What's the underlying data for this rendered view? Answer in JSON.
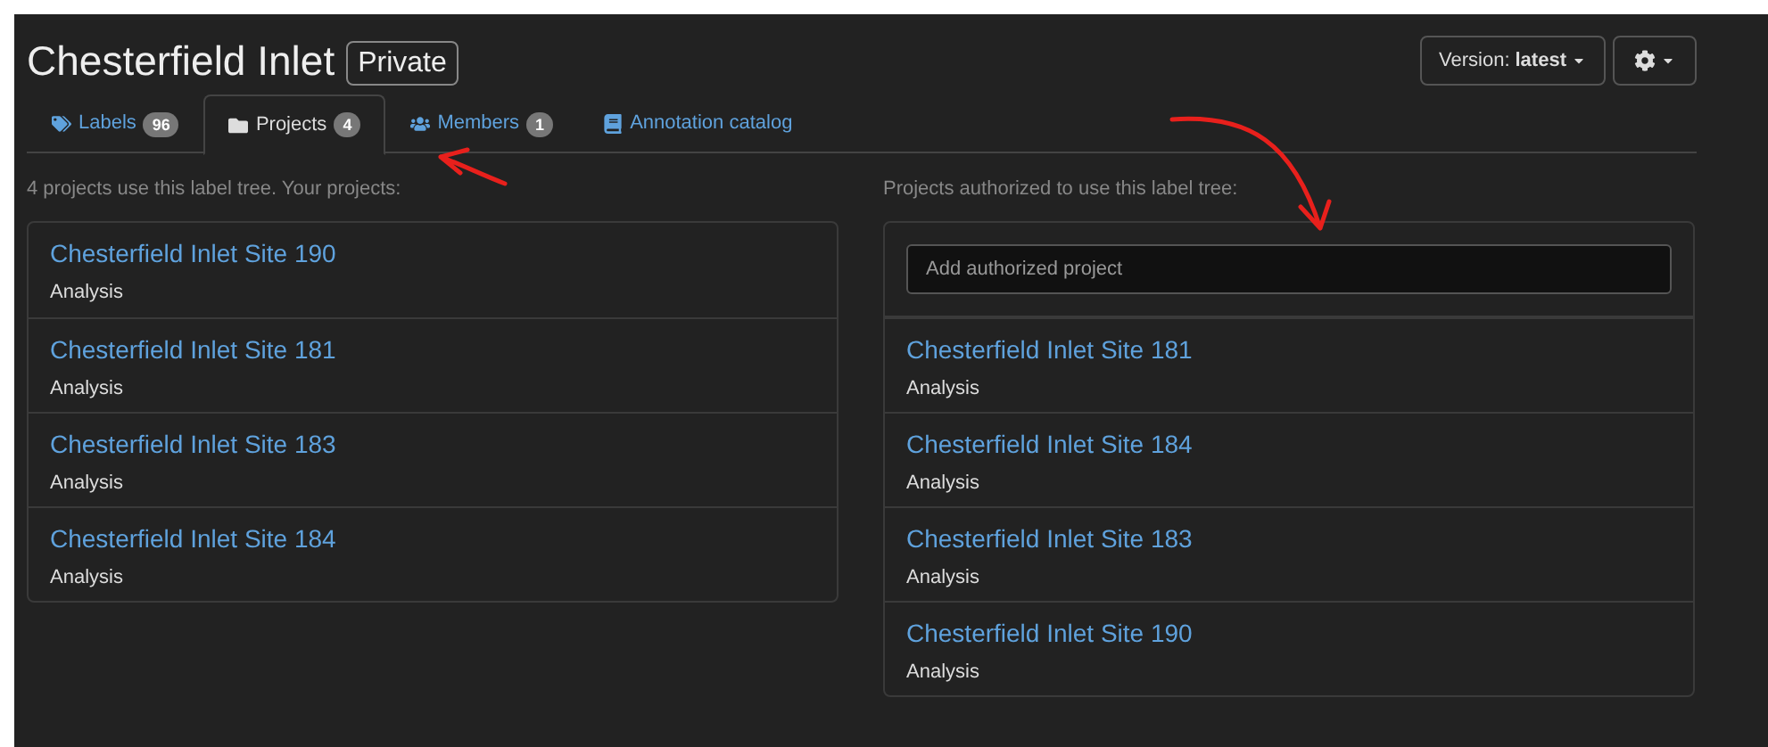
{
  "header": {
    "title": "Chesterfield Inlet",
    "visibility_badge": "Private",
    "version_button": {
      "label": "Version:",
      "value": "latest"
    }
  },
  "tabs": [
    {
      "label": "Labels",
      "count": "96",
      "selected": false
    },
    {
      "label": "Projects",
      "count": "4",
      "selected": true
    },
    {
      "label": "Members",
      "count": "1",
      "selected": false
    },
    {
      "label": "Annotation catalog",
      "selected": false
    }
  ],
  "your_projects": {
    "heading": "4 projects use this label tree. Your projects:",
    "items": [
      {
        "name": "Chesterfield Inlet Site 190",
        "description": "Analysis"
      },
      {
        "name": "Chesterfield Inlet Site 181",
        "description": "Analysis"
      },
      {
        "name": "Chesterfield Inlet Site 183",
        "description": "Analysis"
      },
      {
        "name": "Chesterfield Inlet Site 184",
        "description": "Analysis"
      }
    ]
  },
  "authorized_projects": {
    "heading": "Projects authorized to use this label tree:",
    "search": {
      "placeholder": "Add authorized project"
    },
    "items": [
      {
        "name": "Chesterfield Inlet Site 181",
        "description": "Analysis"
      },
      {
        "name": "Chesterfield Inlet Site 184",
        "description": "Analysis"
      },
      {
        "name": "Chesterfield Inlet Site 183",
        "description": "Analysis"
      },
      {
        "name": "Chesterfield Inlet Site 190",
        "description": "Analysis"
      }
    ]
  }
}
